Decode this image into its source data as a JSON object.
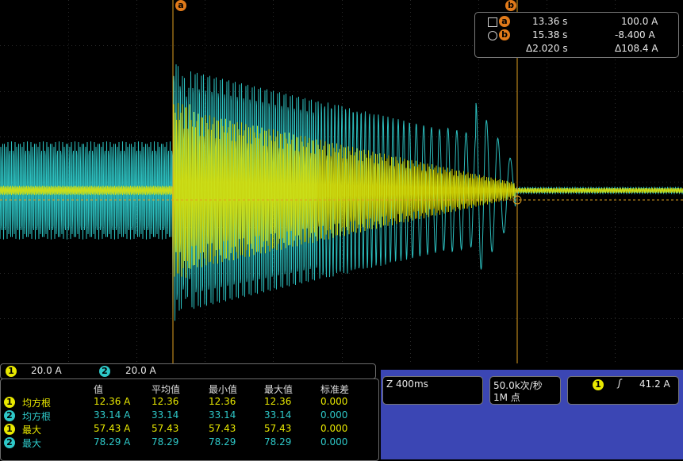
{
  "cursors": {
    "a": {
      "marker": "a",
      "time": "13.36 s",
      "value": "100.0 A"
    },
    "b": {
      "marker": "b",
      "time": "15.38 s",
      "value": "-8.400 A"
    },
    "delta": {
      "time": "Δ2.020 s",
      "value": "Δ108.4 A"
    }
  },
  "channels": {
    "ch1": {
      "num": "1",
      "scale": "20.0 A",
      "color": "#e8e800"
    },
    "ch2": {
      "num": "2",
      "scale": "20.0 A",
      "color": "#2ec8c8"
    }
  },
  "measurements": {
    "headers": [
      "值",
      "平均值",
      "最小值",
      "最大值",
      "标准差"
    ],
    "rows": [
      {
        "ch": "1",
        "name": "均方根",
        "v": [
          "12.36 A",
          "12.36",
          "12.36",
          "12.36",
          "0.000"
        ]
      },
      {
        "ch": "2",
        "name": "均方根",
        "v": [
          "33.14 A",
          "33.14",
          "33.14",
          "33.14",
          "0.000"
        ]
      },
      {
        "ch": "1",
        "name": "最大",
        "v": [
          "57.43 A",
          "57.43",
          "57.43",
          "57.43",
          "0.000"
        ]
      },
      {
        "ch": "2",
        "name": "最大",
        "v": [
          "78.29 A",
          "78.29",
          "78.29",
          "78.29",
          "0.000"
        ]
      }
    ]
  },
  "horizontal": {
    "zoom": "Z 400ms"
  },
  "acquisition": {
    "rate": "50.0k次/秒",
    "points": "1M 点"
  },
  "trigger": {
    "ch": "1",
    "slope_symbol": "ʃ",
    "level": "41.2 A"
  },
  "colors": {
    "ch1": "#e8e800",
    "ch2": "#2ec8c8",
    "cursor": "#e0a020",
    "panel_bg": "#3b46b4"
  }
}
